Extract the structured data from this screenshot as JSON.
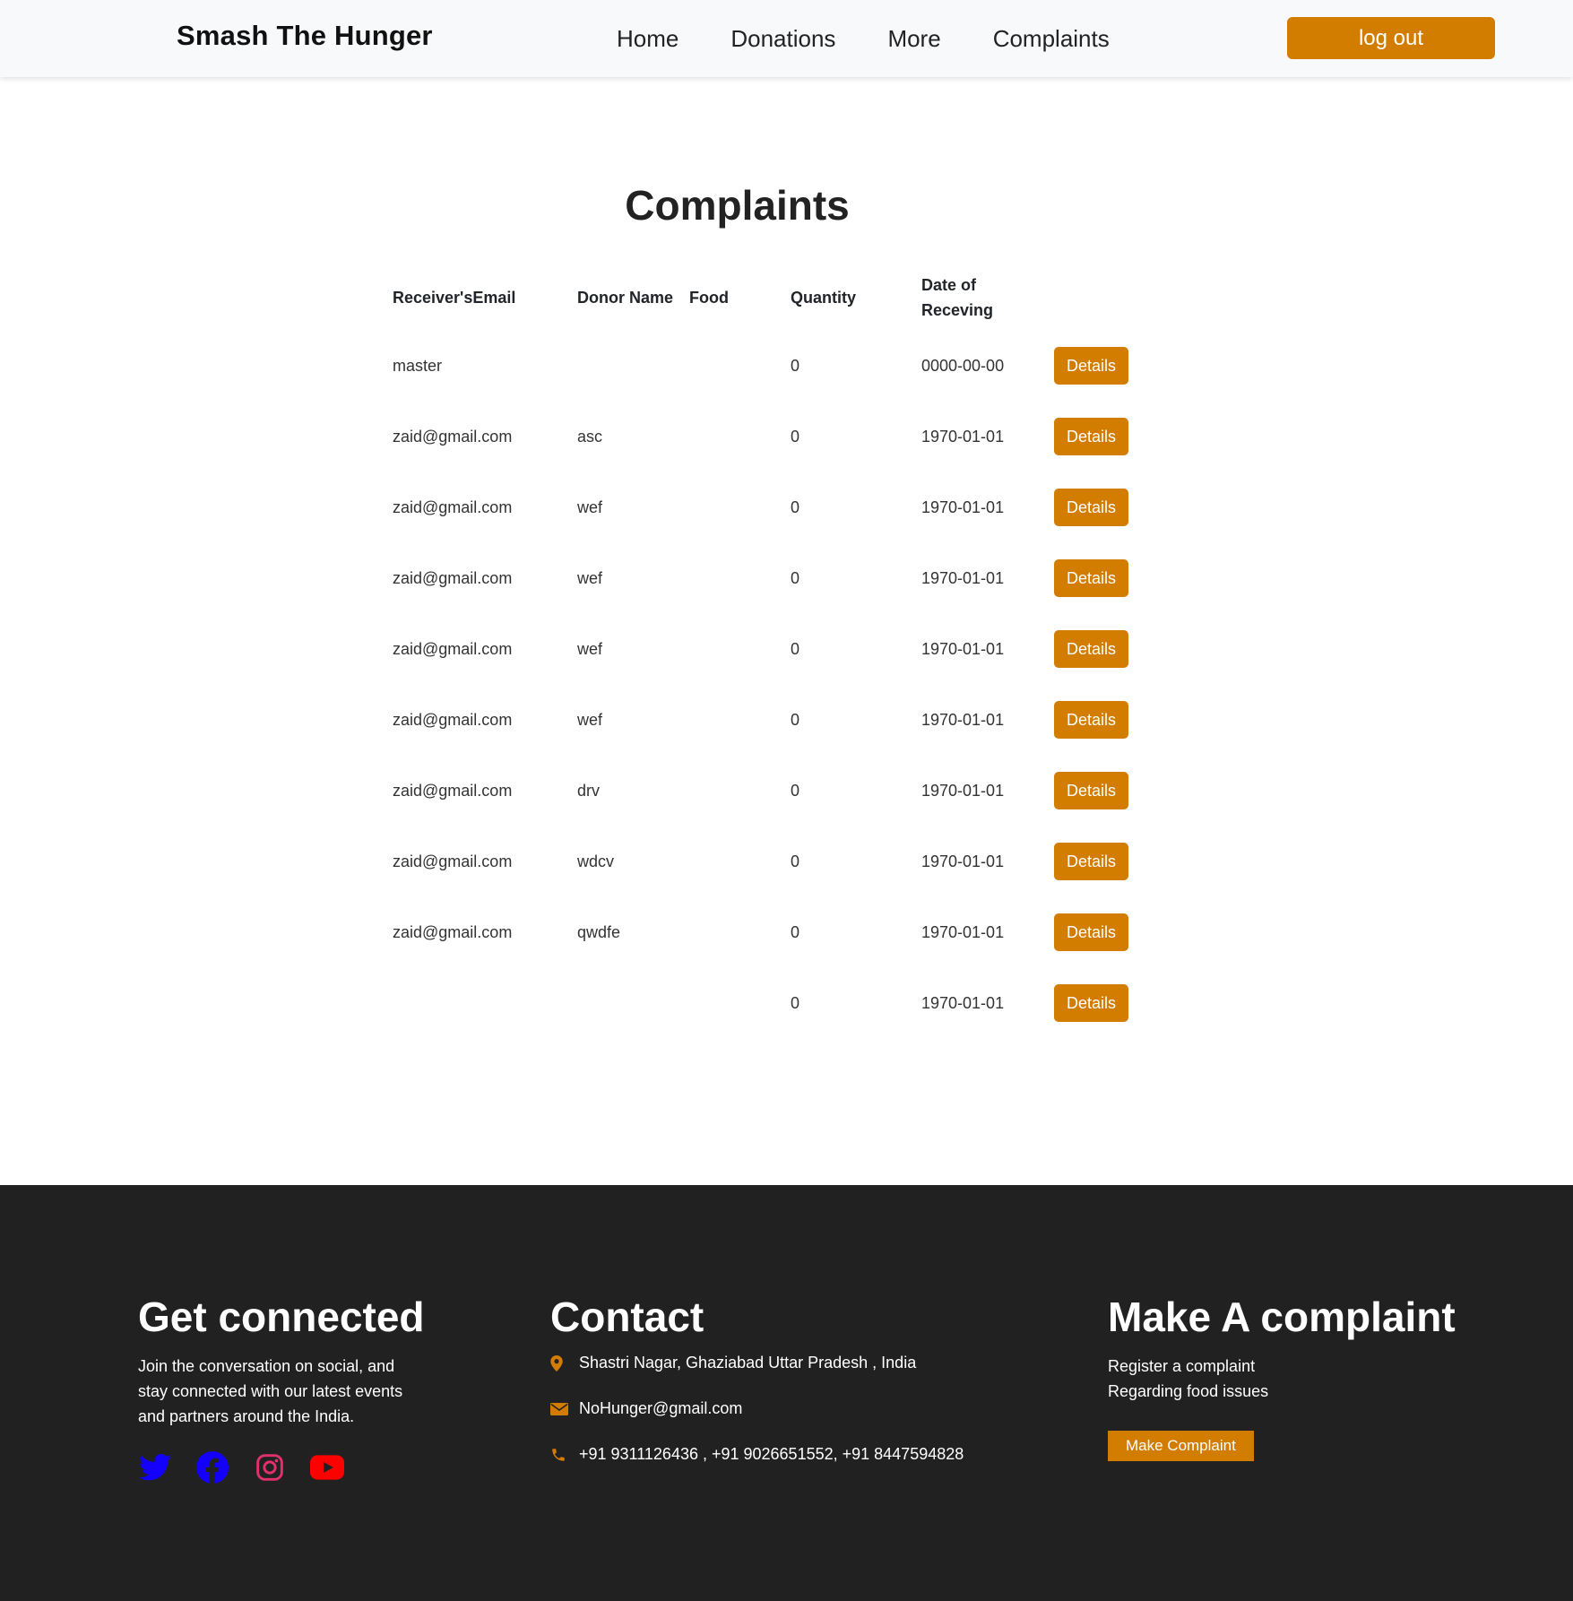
{
  "navbar": {
    "brand": "Smash The Hunger",
    "links": [
      "Home",
      "Donations",
      "More",
      "Complaints"
    ],
    "logout_label": "log out"
  },
  "main": {
    "title": "Complaints",
    "columns": [
      "Receiver'sEmail",
      "Donor Name",
      "Food",
      "Quantity",
      "Date of Receving",
      ""
    ],
    "rows": [
      {
        "email": "master",
        "donor": "",
        "food": "",
        "quantity": "0",
        "date": "0000-00-00",
        "action": "Details"
      },
      {
        "email": "zaid@gmail.com",
        "donor": "asc",
        "food": "",
        "quantity": "0",
        "date": "1970-01-01",
        "action": "Details"
      },
      {
        "email": "zaid@gmail.com",
        "donor": "wef",
        "food": "",
        "quantity": "0",
        "date": "1970-01-01",
        "action": "Details"
      },
      {
        "email": "zaid@gmail.com",
        "donor": "wef",
        "food": "",
        "quantity": "0",
        "date": "1970-01-01",
        "action": "Details"
      },
      {
        "email": "zaid@gmail.com",
        "donor": "wef",
        "food": "",
        "quantity": "0",
        "date": "1970-01-01",
        "action": "Details"
      },
      {
        "email": "zaid@gmail.com",
        "donor": "wef",
        "food": "",
        "quantity": "0",
        "date": "1970-01-01",
        "action": "Details"
      },
      {
        "email": "zaid@gmail.com",
        "donor": "drv",
        "food": "",
        "quantity": "0",
        "date": "1970-01-01",
        "action": "Details"
      },
      {
        "email": "zaid@gmail.com",
        "donor": "wdcv",
        "food": "",
        "quantity": "0",
        "date": "1970-01-01",
        "action": "Details"
      },
      {
        "email": "zaid@gmail.com",
        "donor": "qwdfe",
        "food": "",
        "quantity": "0",
        "date": "1970-01-01",
        "action": "Details"
      },
      {
        "email": "",
        "donor": "",
        "food": "",
        "quantity": "0",
        "date": "1970-01-01",
        "action": "Details"
      }
    ]
  },
  "footer": {
    "connected": {
      "title": "Get connected",
      "text": "Join the conversation on social, and stay connected with our latest events and partners around the India.",
      "socials": [
        {
          "name": "twitter-icon",
          "color": "#1400ff"
        },
        {
          "name": "facebook-icon",
          "color": "#1400ff"
        },
        {
          "name": "instagram-icon",
          "color": "#e1306c"
        },
        {
          "name": "youtube-icon",
          "color": "#ff0000"
        }
      ]
    },
    "contact": {
      "title": "Contact",
      "address": "Shastri Nagar, Ghaziabad Uttar Pradesh , India",
      "email": "NoHunger@gmail.com",
      "phone": "+91 9311126436 , +91 9026651552, +91 8447594828"
    },
    "complaint": {
      "title": "Make A complaint",
      "line1": "Register a complaint",
      "line2": "Regarding food issues",
      "button_label": "Make Complaint"
    }
  },
  "colors": {
    "accent": "#d27c00",
    "footer_bg": "#212121",
    "navbar_bg": "#f8f9fa"
  }
}
